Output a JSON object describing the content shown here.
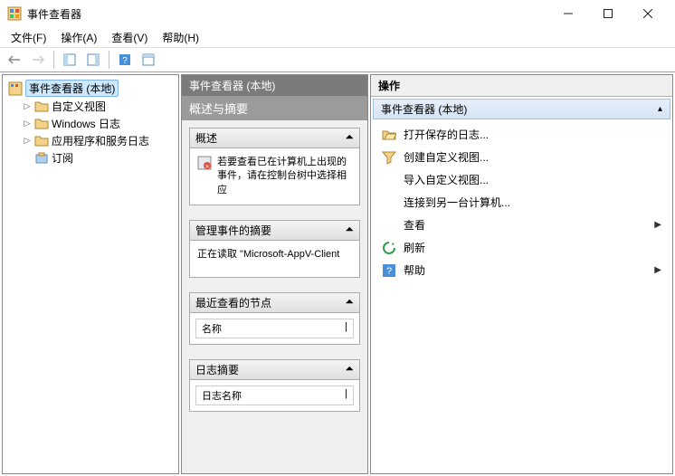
{
  "window": {
    "title": "事件查看器"
  },
  "menus": {
    "file": "文件(F)",
    "action": "操作(A)",
    "view": "查看(V)",
    "help": "帮助(H)"
  },
  "tree": {
    "root": "事件查看器 (本地)",
    "items": [
      "自定义视图",
      "Windows 日志",
      "应用程序和服务日志",
      "订阅"
    ]
  },
  "center": {
    "header": "事件查看器 (本地)",
    "subheader": "概述与摘要",
    "overview": {
      "title": "概述",
      "text": "若要查看已在计算机上出现的事件，请在控制台树中选择相应"
    },
    "admin_summary": {
      "title": "管理事件的摘要",
      "reading": "正在读取 \"Microsoft-AppV-Client"
    },
    "recent": {
      "title": "最近查看的节点",
      "col": "名称"
    },
    "log_summary": {
      "title": "日志摘要",
      "col": "日志名称"
    }
  },
  "right": {
    "header": "操作",
    "section_title": "事件查看器 (本地)",
    "actions": {
      "open_saved": "打开保存的日志...",
      "create_view": "创建自定义视图...",
      "import_view": "导入自定义视图...",
      "connect": "连接到另一台计算机...",
      "view": "查看",
      "refresh": "刷新",
      "help": "帮助"
    }
  }
}
